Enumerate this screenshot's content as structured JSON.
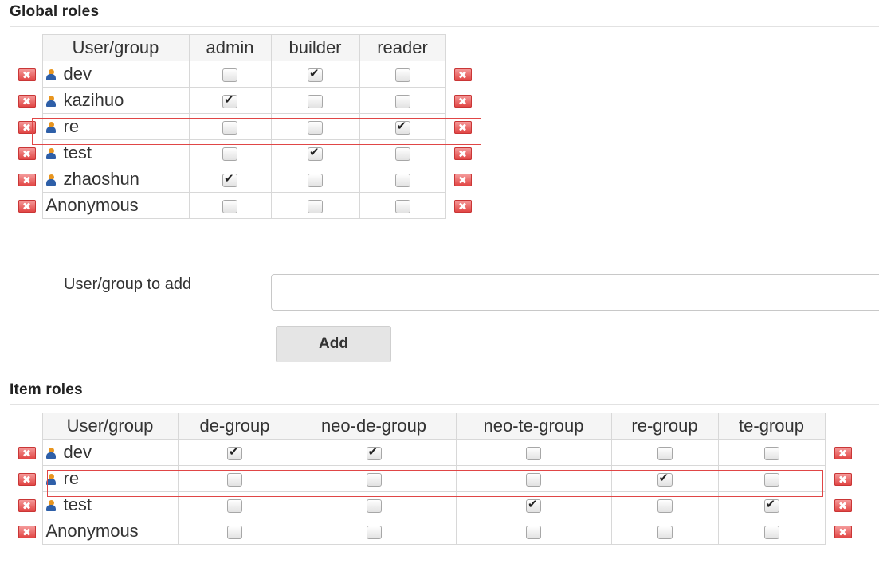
{
  "global_roles": {
    "title": "Global roles",
    "columns": [
      "User/group",
      "admin",
      "builder",
      "reader"
    ],
    "rows": [
      {
        "name": "dev",
        "icon": "user-icon",
        "checks": [
          false,
          true,
          false
        ]
      },
      {
        "name": "kazihuo",
        "icon": "user-icon",
        "checks": [
          true,
          false,
          false
        ]
      },
      {
        "name": "re",
        "icon": "user-icon",
        "checks": [
          false,
          false,
          true
        ],
        "highlighted": true
      },
      {
        "name": "test",
        "icon": "user-icon",
        "checks": [
          false,
          true,
          false
        ]
      },
      {
        "name": "zhaoshun",
        "icon": "user-icon",
        "checks": [
          true,
          false,
          false
        ]
      },
      {
        "name": "Anonymous",
        "icon": null,
        "checks": [
          false,
          false,
          false
        ]
      }
    ]
  },
  "add_form": {
    "label": "User/group to add",
    "input_value": "",
    "button_label": "Add"
  },
  "item_roles": {
    "title": "Item roles",
    "columns": [
      "User/group",
      "de-group",
      "neo-de-group",
      "neo-te-group",
      "re-group",
      "te-group"
    ],
    "rows": [
      {
        "name": "dev",
        "icon": "user-icon",
        "checks": [
          true,
          true,
          false,
          false,
          false
        ]
      },
      {
        "name": "re",
        "icon": "user-icon",
        "checks": [
          false,
          false,
          false,
          true,
          false
        ],
        "highlighted": true
      },
      {
        "name": "test",
        "icon": "user-icon",
        "checks": [
          false,
          false,
          true,
          false,
          true
        ]
      },
      {
        "name": "Anonymous",
        "icon": null,
        "checks": [
          false,
          false,
          false,
          false,
          false
        ]
      }
    ]
  },
  "colors": {
    "highlight": "#e04646",
    "delete_icon": "#e0403f",
    "user_icon_head": "#e8951f",
    "user_icon_body": "#2e5fa8"
  }
}
